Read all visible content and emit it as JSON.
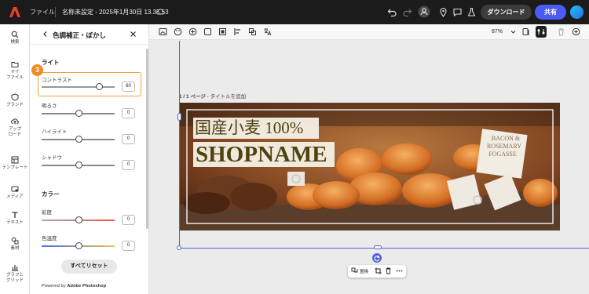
{
  "topbar": {
    "menu_label": "ファイル",
    "doc_title": "名称未設定 - 2025年1月30日 13.35.53",
    "download_label": "ダウンロード",
    "share_label": "共有",
    "brand_color": "#f2411c",
    "share_color": "#4b5cf5"
  },
  "rail": {
    "items": [
      {
        "label": "検索",
        "icon": "search-icon"
      },
      {
        "label": "マイ\nファイル",
        "icon": "folder-icon"
      },
      {
        "label": "ブランド",
        "icon": "brand-icon"
      },
      {
        "label": "アップ\nロード",
        "icon": "upload-icon"
      },
      {
        "label": "テンプレート",
        "icon": "template-icon"
      },
      {
        "label": "メディア",
        "icon": "media-icon"
      },
      {
        "label": "テキスト",
        "icon": "text-icon"
      },
      {
        "label": "素材",
        "icon": "elements-icon"
      },
      {
        "label": "グラフと\nグリッド",
        "icon": "chart-grid-icon"
      }
    ]
  },
  "panel": {
    "title": "色調補正・ぼかし",
    "section_light": "ライト",
    "section_color": "カラー",
    "sliders": [
      {
        "label": "コントラスト",
        "value": "60"
      },
      {
        "label": "明るさ",
        "value": "0"
      },
      {
        "label": "ハイライト",
        "value": "0"
      },
      {
        "label": "シャドウ",
        "value": "0"
      },
      {
        "label": "彩度",
        "value": "0"
      },
      {
        "label": "色温度",
        "value": "0"
      }
    ],
    "step_badge": "3",
    "reset_label": "すべてリセット",
    "powered_prefix": "Powered by ",
    "powered_brand": "Adobe Photoshop"
  },
  "toolbar": {
    "zoom": "87%"
  },
  "canvas": {
    "page_number": "1 / 1 ページ",
    "page_title_placeholder": " - タイトルを追加",
    "banner_line1": "国産小麦 100%",
    "banner_line2": "SHOPNAME",
    "sign_text": "BACON &\nROSEMARY\nFOGASSE",
    "replace_label": "置換"
  }
}
